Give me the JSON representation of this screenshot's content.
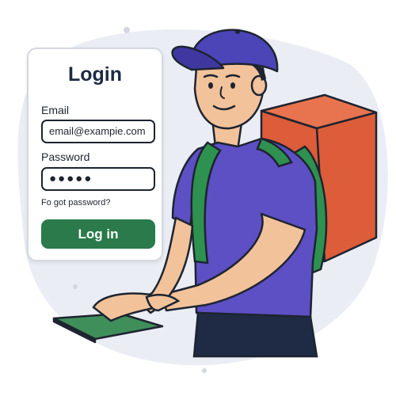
{
  "login": {
    "title": "Login",
    "email_label": "Email",
    "email_value": "email@exampie.com",
    "password_label": "Password",
    "password_value": "●●●●●",
    "forgot_link": "Fo got password?",
    "submit_label": "Log in"
  },
  "colors": {
    "primary_button": "#2a7a4b",
    "cap": "#4b45b8",
    "shirt": "#5d4fc4",
    "backpack_straps": "#2e9150",
    "delivery_box": "#dd5c3a",
    "phone_screen": "#3f8f5a"
  }
}
